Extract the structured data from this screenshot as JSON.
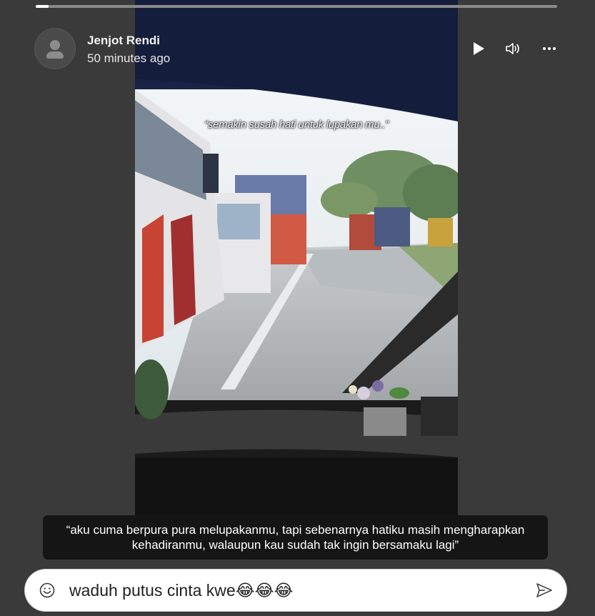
{
  "progress": {
    "fraction": 0.025
  },
  "story": {
    "author": "Jenjot Rendi",
    "time": "50 minutes ago",
    "video_overlay_text": "“semakin susah hati untuk lupakan mu..”",
    "caption": "“aku cuma berpura pura melupakanmu, tapi sebenarnya hatiku masih mengharapkan kehadiranmu, walaupun kau sudah tak ingin bersamaku lagi”"
  },
  "controls": {
    "play_icon": "play-icon",
    "volume_icon": "volume-icon",
    "more_icon": "more-icon"
  },
  "reply": {
    "value": "waduh putus cinta kwe😂😂😂",
    "emoji_icon": "smiley-icon",
    "send_icon": "send-icon"
  },
  "colors": {
    "background": "#3a3a3a",
    "caption_bg": "#151515",
    "progress_fill": "#ffffff",
    "progress_track": "#8a8a8a"
  }
}
